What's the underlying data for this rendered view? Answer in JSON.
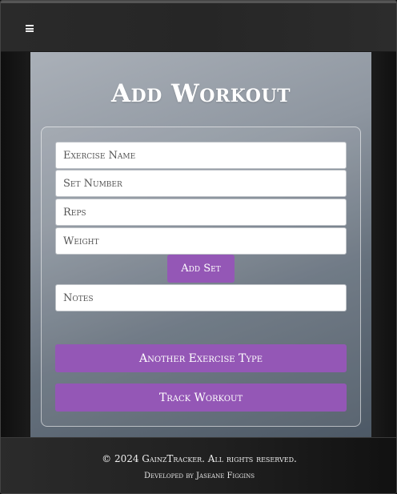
{
  "header": {
    "menu_icon": "hamburger-menu-icon"
  },
  "page": {
    "title": "Add Workout"
  },
  "form": {
    "exercise_name_placeholder": "Exercise Name",
    "set_number_placeholder": "Set Number",
    "reps_placeholder": "Reps",
    "weight_placeholder": "Weight",
    "add_set_label": "Add Set",
    "notes_placeholder": "Notes",
    "another_exercise_label": "Another Exercise Type",
    "track_workout_label": "Track Workout"
  },
  "footer": {
    "copyright": "© 2024 GainzTracker. All rights reserved.",
    "developer": "Developed by Jaseane Figgins"
  },
  "colors": {
    "accent": "#9457b6",
    "header_bg": "#282828",
    "footer_bg": "#202020"
  }
}
